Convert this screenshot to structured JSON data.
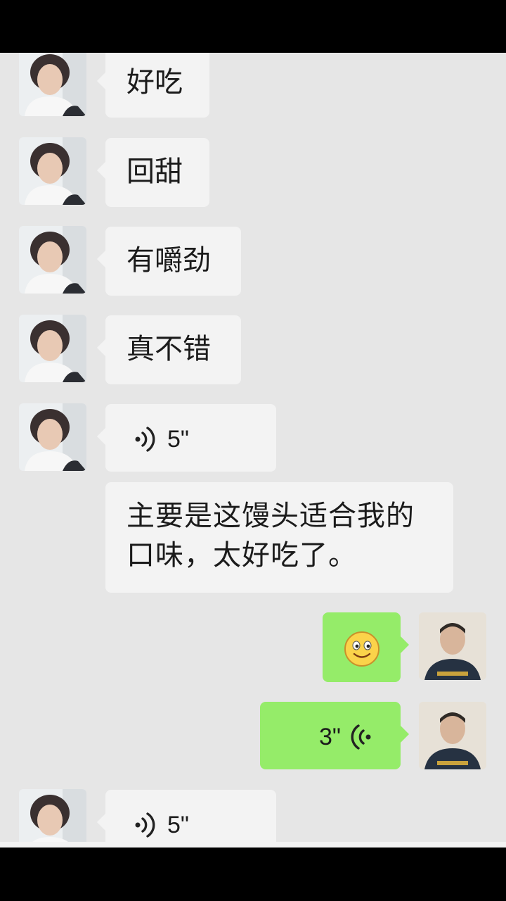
{
  "messages": {
    "m1": {
      "text": "好吃"
    },
    "m2": {
      "text": "回甜"
    },
    "m3": {
      "text": "有嚼劲"
    },
    "m4": {
      "text": "真不错"
    },
    "m5": {
      "voice_duration": "5\""
    },
    "m6": {
      "text": "主要是这馒头适合我的口味，太好吃了。"
    },
    "m7": {
      "emoji": "smiley-face"
    },
    "m8": {
      "voice_duration": "3\""
    },
    "m9": {
      "voice_duration": "5\""
    }
  },
  "colors": {
    "chat_background": "#e6e6e6",
    "incoming_bubble": "#f3f3f3",
    "outgoing_bubble": "#95ec69",
    "screen_frame": "#000000"
  },
  "icons": {
    "voice": "voice-wave-icon",
    "emoji": "smiley-emoji-icon"
  }
}
